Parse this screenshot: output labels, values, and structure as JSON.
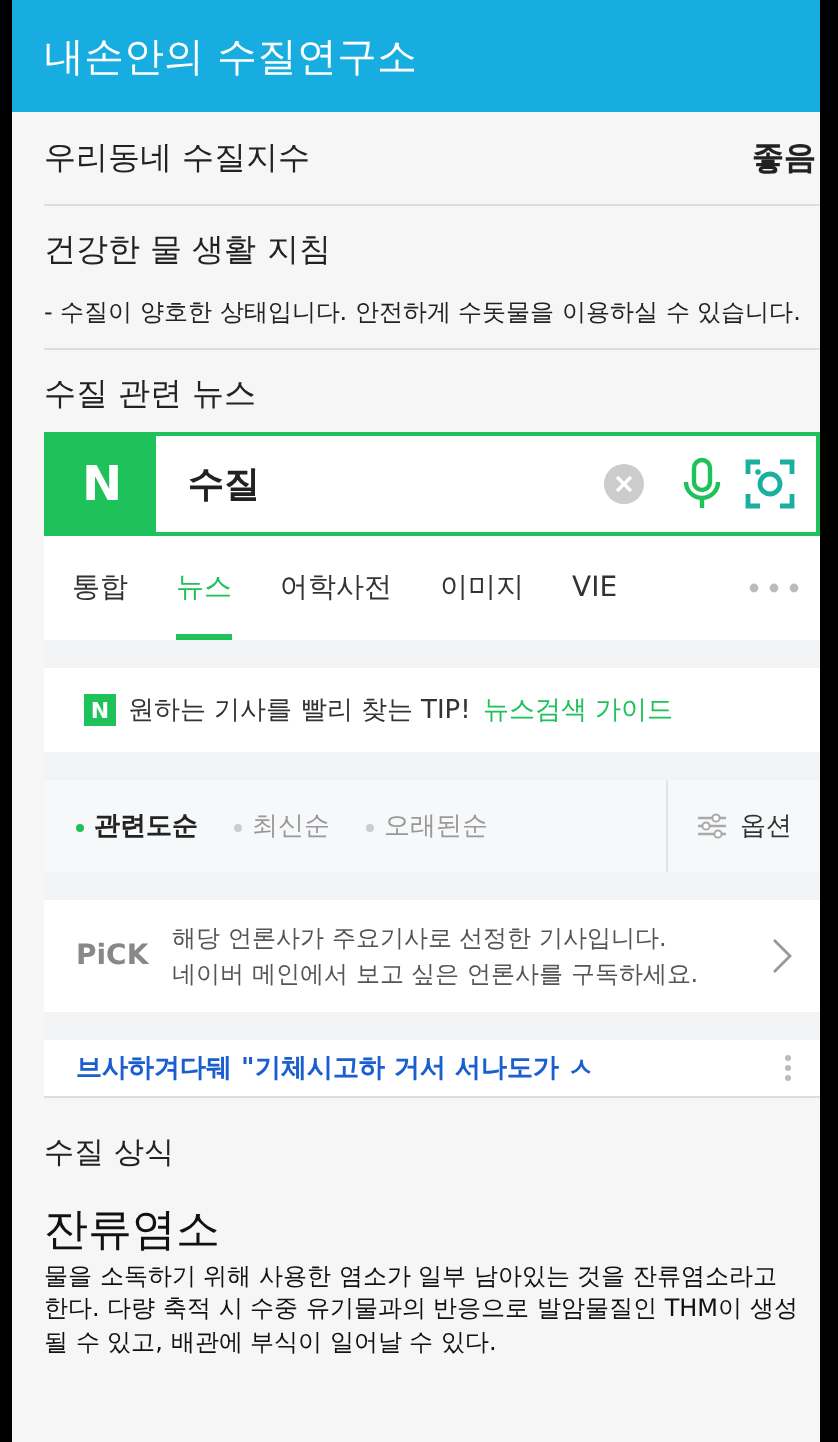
{
  "app_bar": {
    "title": "내손안의 수질연구소"
  },
  "water_index": {
    "label": "우리동네 수질지수",
    "value": "좋음"
  },
  "guideline": {
    "title": "건강한 물 생활 지침",
    "text": "- 수질이 양호한 상태입니다. 안전하게 수돗물을 이용하실 수 있습니다."
  },
  "news": {
    "title": "수질 관련 뉴스",
    "search": {
      "logo": "N",
      "value": "수질"
    },
    "tabs": [
      {
        "label": "통합",
        "selected": false
      },
      {
        "label": "뉴스",
        "selected": true
      },
      {
        "label": "어학사전",
        "selected": false
      },
      {
        "label": "이미지",
        "selected": false
      },
      {
        "label": "VIE",
        "selected": false
      }
    ],
    "tip": {
      "logo": "N",
      "text": "원하는 기사를 빨리 찾는 TIP!",
      "link": "뉴스검색 가이드"
    },
    "sort": [
      {
        "label": "관련도순",
        "selected": true
      },
      {
        "label": "최신순",
        "selected": false
      },
      {
        "label": "오래된순",
        "selected": false
      }
    ],
    "options": "옵션",
    "pick": {
      "badge": "PiCK",
      "lines": [
        "해당 언론사가 주요기사로 선정한 기사입니다.",
        "네이버 메인에서 보고 싶은 언론사를 구독하세요."
      ]
    },
    "headline": "브사하겨다뒈 \"기체시고하 거서  서나도가 ㅅ"
  },
  "knowledge": {
    "title": "수질 상식",
    "term": "잔류염소",
    "text": "물을 소독하기 위해 사용한 염소가 일부 남아있는 것을 잔류염소라고 한다. 다량 축적 시 수중 유기물과의 반응으로 발암물질인 THM이 생성될 수 있고, 배관에 부식이 일어날 수 있다."
  }
}
